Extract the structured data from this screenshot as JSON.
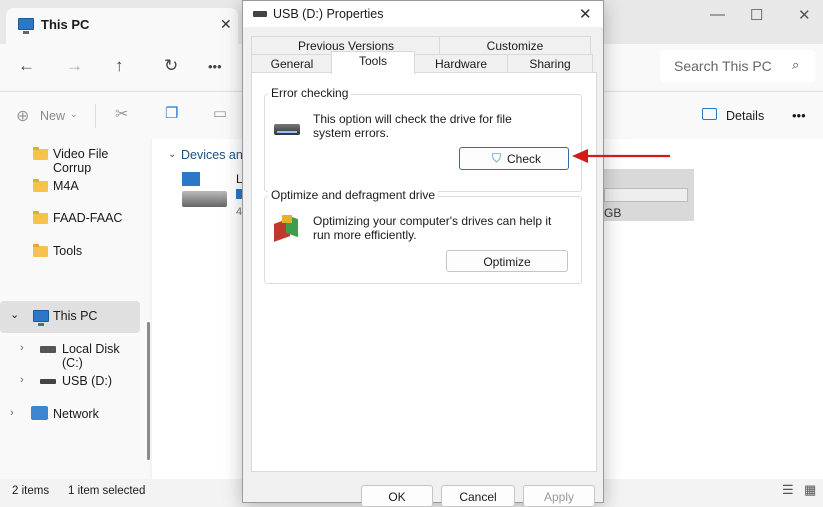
{
  "explorer": {
    "tab_title": "This PC",
    "tab_close": "✕",
    "tab_new": "+",
    "window_controls": {
      "minimize": "—",
      "maximize": "☐",
      "close": "✕"
    },
    "nav": {
      "back": "←",
      "forward": "→",
      "up": "↑",
      "refresh": "↻",
      "more": "•••"
    },
    "search_placeholder": "Search This PC",
    "toolbar": {
      "new_label": "New",
      "details_label": "Details",
      "more": "•••"
    },
    "tree": [
      {
        "label": "Video File Corrup",
        "icon": "folder-icon"
      },
      {
        "label": "M4A",
        "icon": "folder-icon"
      },
      {
        "label": "FAAD-FAAC",
        "icon": "folder-icon"
      },
      {
        "label": "Tools",
        "icon": "folder-icon"
      },
      {
        "label": "This PC",
        "icon": "pc-icon",
        "selected": true
      },
      {
        "label": "Local Disk (C:)",
        "icon": "disk-icon"
      },
      {
        "label": "USB (D:)",
        "icon": "usb-drive-icon"
      },
      {
        "label": "Network",
        "icon": "network-icon"
      }
    ],
    "group_header": "Devices and",
    "drive_partial_label": "L",
    "drive_partial_size": "4",
    "usb_tile_size_fragment": "GB",
    "status": {
      "items": "2 items",
      "selected": "1 item selected"
    }
  },
  "dialog": {
    "title": "USB (D:) Properties",
    "close": "✕",
    "tabs_row1": [
      "Previous Versions",
      "Customize"
    ],
    "tabs_row2": [
      "General",
      "Tools",
      "Hardware",
      "Sharing"
    ],
    "active_tab": "Tools",
    "error_checking": {
      "legend": "Error checking",
      "text": "This option will check the drive for file system errors.",
      "button": "Check"
    },
    "optimize": {
      "legend": "Optimize and defragment drive",
      "text": "Optimizing your computer's drives can help it run more efficiently.",
      "button": "Optimize"
    },
    "buttons": {
      "ok": "OK",
      "cancel": "Cancel",
      "apply": "Apply"
    }
  },
  "annotation": {
    "arrow_color": "#d01c1c"
  }
}
